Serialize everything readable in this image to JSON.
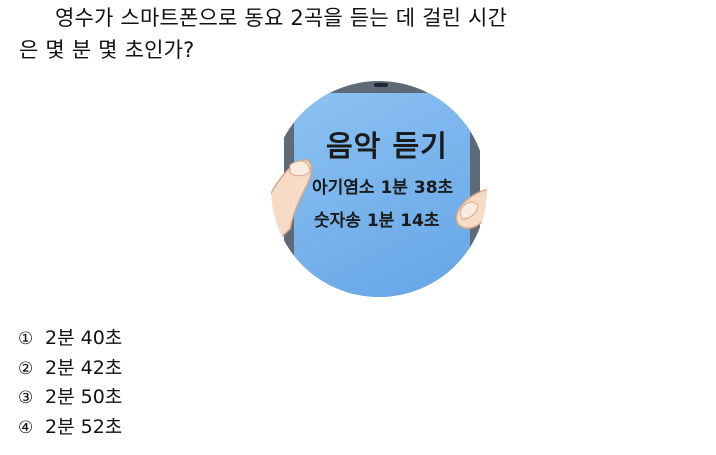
{
  "question": {
    "line1": "영수가 스마트폰으로 동요 2곡을 듣는 데 걸린 시간",
    "line2": "은 몇 분 몇 초인가?"
  },
  "phone": {
    "title": "음악 듣기",
    "songs": [
      "아기염소 1분 38초",
      "숫자송 1분 14초"
    ],
    "colors": {
      "screen": "#7fb8ee",
      "frame": "#5f6a78",
      "hand": "#f6dcc6"
    }
  },
  "choices": [
    {
      "num": "①",
      "text": "2분 40초"
    },
    {
      "num": "②",
      "text": "2분 42초"
    },
    {
      "num": "③",
      "text": "2분 50초"
    },
    {
      "num": "④",
      "text": "2분 52초"
    }
  ]
}
